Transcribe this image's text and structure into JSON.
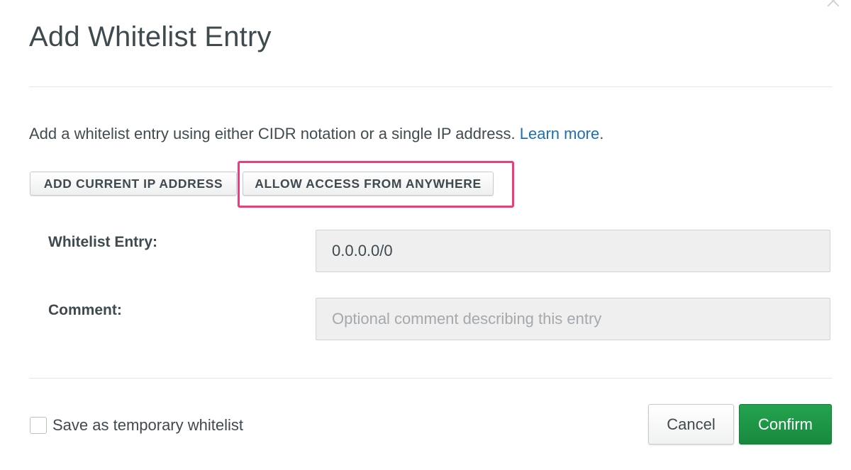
{
  "dialog": {
    "title": "Add Whitelist Entry"
  },
  "intro": {
    "text": "Add a whitelist entry using either CIDR notation or a single IP address. ",
    "link_label": "Learn more",
    "trailing": "."
  },
  "buttons": {
    "add_current_ip": "ADD CURRENT IP ADDRESS",
    "allow_anywhere": "ALLOW ACCESS FROM ANYWHERE",
    "cancel": "Cancel",
    "confirm": "Confirm"
  },
  "fields": {
    "whitelist_entry": {
      "label": "Whitelist Entry:",
      "value": "0.0.0.0/0"
    },
    "comment": {
      "label": "Comment:",
      "value": "",
      "placeholder": "Optional comment describing this entry"
    }
  },
  "temporary": {
    "label": "Save as temporary whitelist",
    "checked": false
  },
  "colors": {
    "link": "#1e6fb0",
    "confirm_green": "#1f9a48",
    "highlight": "#ef3a7c"
  },
  "icons": {
    "close": "close-icon"
  }
}
